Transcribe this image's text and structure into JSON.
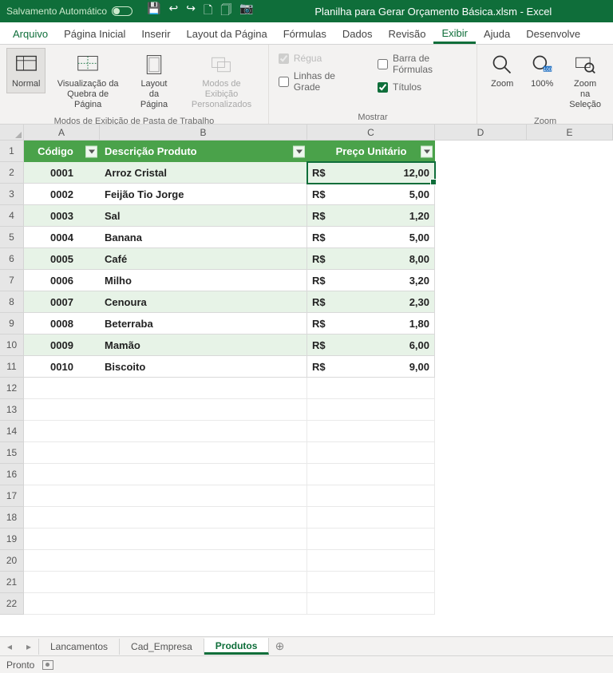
{
  "titlebar": {
    "autosave_label": "Salvamento Automático",
    "filename": "Planilha para Gerar Orçamento Básica.xlsm",
    "app": "Excel"
  },
  "ribbon_tabs": {
    "file": "Arquivo",
    "home": "Página Inicial",
    "insert": "Inserir",
    "layout": "Layout da Página",
    "formulas": "Fórmulas",
    "data": "Dados",
    "review": "Revisão",
    "view": "Exibir",
    "help": "Ajuda",
    "developer": "Desenvolve"
  },
  "ribbon": {
    "group_views_label": "Modos de Exibição de Pasta de Trabalho",
    "btn_normal": "Normal",
    "btn_pagebreak": "Visualização da\nQuebra de Página",
    "btn_pagelayout": "Layout\nda Página",
    "btn_custom": "Modos de Exibição\nPersonalizados",
    "group_show_label": "Mostrar",
    "chk_ruler": "Régua",
    "chk_gridlines": "Linhas de Grade",
    "chk_formula_bar": "Barra de Fórmulas",
    "chk_headings": "Títulos",
    "group_zoom_label": "Zoom",
    "btn_zoom": "Zoom",
    "btn_100": "100%",
    "btn_zoom_sel": "Zoom na\nSeleção"
  },
  "columns": [
    "A",
    "B",
    "C",
    "D",
    "E"
  ],
  "table": {
    "headers": {
      "codigo": "Código",
      "descricao": "Descrição Produto",
      "preco": "Preço Unitário"
    },
    "currency": "R$",
    "rows": [
      {
        "codigo": "0001",
        "descricao": "Arroz Cristal",
        "preco": "12,00"
      },
      {
        "codigo": "0002",
        "descricao": "Feijão Tio Jorge",
        "preco": "5,00"
      },
      {
        "codigo": "0003",
        "descricao": "Sal",
        "preco": "1,20"
      },
      {
        "codigo": "0004",
        "descricao": "Banana",
        "preco": "5,00"
      },
      {
        "codigo": "0005",
        "descricao": "Café",
        "preco": "8,00"
      },
      {
        "codigo": "0006",
        "descricao": "Milho",
        "preco": "3,20"
      },
      {
        "codigo": "0007",
        "descricao": "Cenoura",
        "preco": "2,30"
      },
      {
        "codigo": "0008",
        "descricao": "Beterraba",
        "preco": "1,80"
      },
      {
        "codigo": "0009",
        "descricao": "Mamão",
        "preco": "6,00"
      },
      {
        "codigo": "0010",
        "descricao": "Biscoito",
        "preco": "9,00"
      }
    ]
  },
  "empty_rows": [
    "12",
    "13",
    "14",
    "15",
    "16",
    "17",
    "18",
    "19",
    "20",
    "21",
    "22"
  ],
  "sheets": {
    "s1": "Lancamentos",
    "s2": "Cad_Empresa",
    "s3": "Produtos"
  },
  "status": {
    "ready": "Pronto"
  }
}
